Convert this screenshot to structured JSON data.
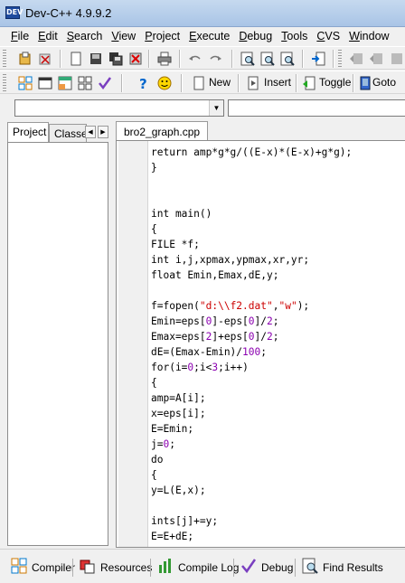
{
  "window": {
    "title": "Dev-C++ 4.9.9.2",
    "icon_text": "DEV"
  },
  "menu": [
    {
      "label": "File",
      "key": "F",
      "rest": "ile"
    },
    {
      "label": "Edit",
      "key": "E",
      "rest": "dit"
    },
    {
      "label": "Search",
      "key": "S",
      "rest": "earch"
    },
    {
      "label": "View",
      "key": "V",
      "rest": "iew"
    },
    {
      "label": "Project",
      "key": "P",
      "rest": "roject"
    },
    {
      "label": "Execute",
      "key": "E",
      "rest": "xecute"
    },
    {
      "label": "Debug",
      "key": "D",
      "rest": "ebug"
    },
    {
      "label": "Tools",
      "key": "T",
      "rest": "ools"
    },
    {
      "label": "CVS",
      "key": "C",
      "rest": "VS"
    },
    {
      "label": "Window",
      "key": "W",
      "rest": "indow"
    }
  ],
  "toolbar2": {
    "new_label": "New",
    "insert_label": "Insert",
    "toggle_label": "Toggle",
    "goto_label": "Goto"
  },
  "left_panel": {
    "tabs": [
      "Project",
      "Classe"
    ]
  },
  "editor": {
    "tab_label": "bro2_graph.cpp",
    "lines": [
      [
        [
          "return amp*g*g/((E-x)*(E-x)+g*g);",
          ""
        ]
      ],
      [
        [
          "}",
          ""
        ]
      ],
      [
        [
          "",
          ""
        ]
      ],
      [
        [
          "",
          ""
        ]
      ],
      [
        [
          "int main()",
          ""
        ]
      ],
      [
        [
          "{",
          ""
        ]
      ],
      [
        [
          "FILE *f;",
          ""
        ]
      ],
      [
        [
          "int i,j,xpmax,ypmax,xr,yr;",
          ""
        ]
      ],
      [
        [
          "float Emin,Emax,dE,y;",
          ""
        ]
      ],
      [
        [
          "",
          ""
        ]
      ],
      [
        [
          "f=fopen(",
          ""
        ],
        [
          "\"d:\\\\f2.dat\"",
          "str"
        ],
        [
          ",",
          ""
        ],
        [
          "\"w\"",
          "str"
        ],
        [
          ");",
          ""
        ]
      ],
      [
        [
          "Emin=eps[",
          ""
        ],
        [
          "0",
          "num"
        ],
        [
          "]-eps[",
          ""
        ],
        [
          "0",
          "num"
        ],
        [
          "]/",
          ""
        ],
        [
          "2",
          "num"
        ],
        [
          ";",
          ""
        ]
      ],
      [
        [
          "Emax=eps[",
          ""
        ],
        [
          "2",
          "num"
        ],
        [
          "]+eps[",
          ""
        ],
        [
          "0",
          "num"
        ],
        [
          "]/",
          ""
        ],
        [
          "2",
          "num"
        ],
        [
          ";",
          ""
        ]
      ],
      [
        [
          "dE=(Emax-Emin)/",
          ""
        ],
        [
          "100",
          "num"
        ],
        [
          ";",
          ""
        ]
      ],
      [
        [
          "for(i=",
          ""
        ],
        [
          "0",
          "num"
        ],
        [
          ";i<",
          ""
        ],
        [
          "3",
          "num"
        ],
        [
          ";i++)",
          ""
        ]
      ],
      [
        [
          "{",
          ""
        ]
      ],
      [
        [
          "amp=A[i];",
          ""
        ]
      ],
      [
        [
          "x=eps[i];",
          ""
        ]
      ],
      [
        [
          "E=Emin;",
          ""
        ]
      ],
      [
        [
          "j=",
          ""
        ],
        [
          "0",
          "num"
        ],
        [
          ";",
          ""
        ]
      ],
      [
        [
          "do",
          ""
        ]
      ],
      [
        [
          "{",
          ""
        ]
      ],
      [
        [
          "y=L(E,x);",
          ""
        ]
      ],
      [
        [
          "",
          ""
        ]
      ],
      [
        [
          "ints[j]+=y;",
          ""
        ]
      ],
      [
        [
          "E=E+dE;",
          ""
        ]
      ]
    ]
  },
  "bottom_tabs": [
    {
      "label": "Compiler",
      "icon": "compiler-icon"
    },
    {
      "label": "Resources",
      "icon": "resources-icon"
    },
    {
      "label": "Compile Log",
      "icon": "compile-log-icon"
    },
    {
      "label": "Debug",
      "icon": "debug-icon"
    },
    {
      "label": "Find Results",
      "icon": "find-results-icon"
    }
  ],
  "colors": {
    "string": "#cc0000",
    "number": "#8b00b0",
    "accent": "#1f4b9e"
  }
}
